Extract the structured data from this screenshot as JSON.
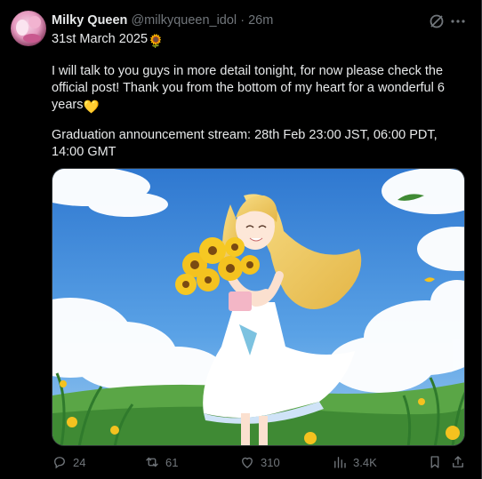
{
  "post": {
    "author_name": "Milky Queen",
    "handle": "@milkyqueen_idol",
    "separator": "·",
    "time": "26m",
    "lines": {
      "date": "31st March 2025",
      "body": "I will talk to you guys in more detail tonight, for now please check the official post! Thank you from the bottom of my heart for a wonderful 6 years",
      "stream": "Graduation announcement stream: 28th Feb 23:00 JST, 06:00 PDT, 14:00 GMT"
    },
    "emojis": {
      "date_emoji": "🌻",
      "body_emoji": "💛"
    }
  },
  "icons": {
    "grok": "grok-icon",
    "more": "more-icon",
    "reply": "reply-icon",
    "repost": "repost-icon",
    "like": "heart-icon",
    "views": "views-icon",
    "bookmark": "bookmark-icon",
    "share": "share-icon"
  },
  "stats": {
    "replies": "24",
    "reposts": "61",
    "likes": "310",
    "views": "3.4K"
  },
  "colors": {
    "background": "#000000",
    "text": "#e7e9ea",
    "muted": "#71767b",
    "sky": "#3f86d6",
    "grass": "#4f9a3a",
    "sunflower": "#f4c21f"
  }
}
